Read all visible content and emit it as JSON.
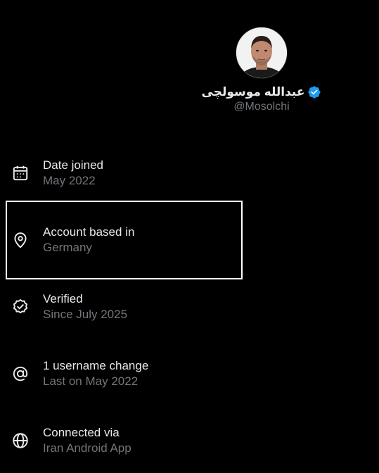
{
  "profile": {
    "display_name": "عبدالله موسولچی",
    "handle": "@Mosolchi",
    "verified": true,
    "badge_color": "#1d9bf0"
  },
  "about": [
    {
      "icon": "calendar-icon",
      "title": "Date joined",
      "value": "May 2022"
    },
    {
      "icon": "location-pin-icon",
      "title": "Account based in",
      "value": "Germany"
    },
    {
      "icon": "verified-check-icon",
      "title": "Verified",
      "value": "Since July 2025"
    },
    {
      "icon": "at-sign-icon",
      "title": "1 username change",
      "value": "Last on May 2022"
    },
    {
      "icon": "globe-icon",
      "title": "Connected via",
      "value": "Iran Android App"
    }
  ],
  "colors": {
    "background": "#000000",
    "primary_text": "#e7e9ea",
    "secondary_text": "#71767b",
    "highlight_border": "#ffffff"
  }
}
